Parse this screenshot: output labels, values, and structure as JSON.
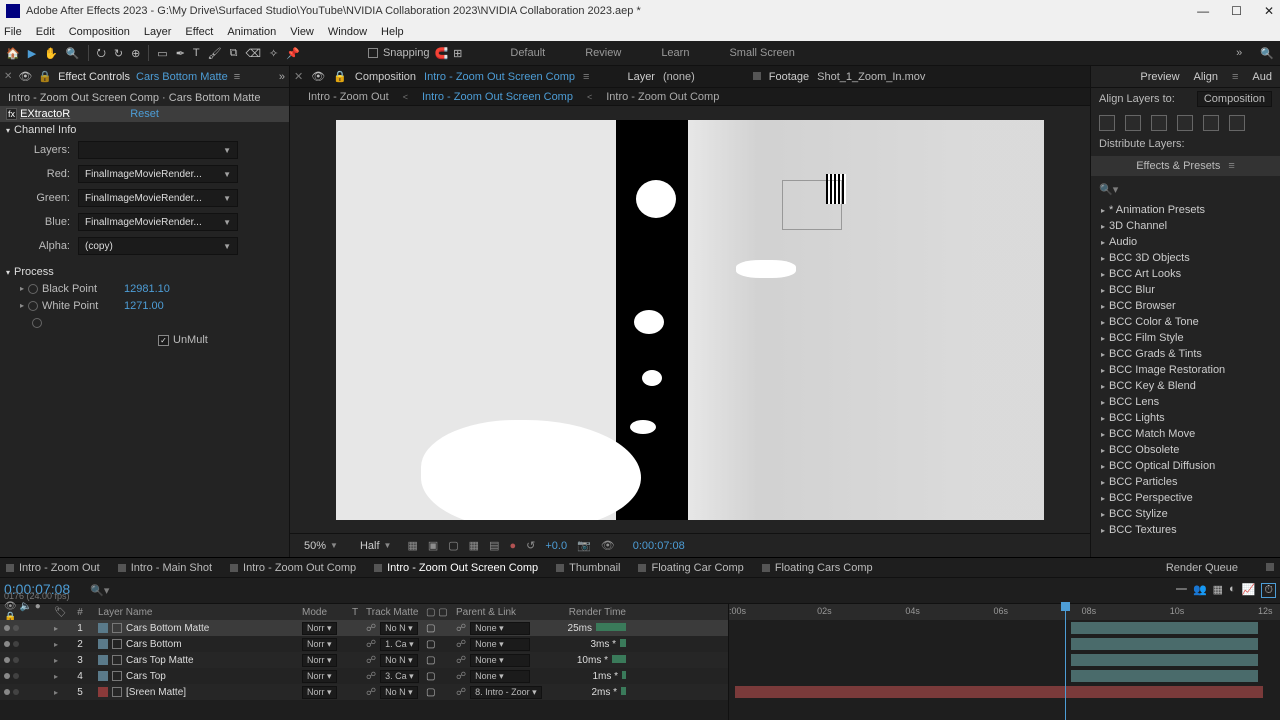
{
  "title": "Adobe After Effects 2023 - G:\\My Drive\\Surfaced Studio\\YouTube\\NVIDIA Collaboration 2023\\NVIDIA Collaboration 2023.aep *",
  "menu": [
    "File",
    "Edit",
    "Composition",
    "Layer",
    "Effect",
    "Animation",
    "View",
    "Window",
    "Help"
  ],
  "toolbar": {
    "snapping": "Snapping"
  },
  "workspaces": [
    "Default",
    "Review",
    "Learn",
    "Small Screen"
  ],
  "effectControls": {
    "title": "Effect Controls",
    "layer": "Cars Bottom Matte",
    "path": "Intro - Zoom Out Screen Comp · Cars Bottom Matte",
    "effect": {
      "name": "EXtractoR",
      "reset": "Reset"
    },
    "section1": "Channel Info",
    "rows": {
      "layers": {
        "label": "Layers:",
        "value": ""
      },
      "red": {
        "label": "Red:",
        "value": "FinalImageMovieRender..."
      },
      "green": {
        "label": "Green:",
        "value": "FinalImageMovieRender..."
      },
      "blue": {
        "label": "Blue:",
        "value": "FinalImageMovieRender..."
      },
      "alpha": {
        "label": "Alpha:",
        "value": "(copy)"
      }
    },
    "section2": "Process",
    "black": {
      "label": "Black Point",
      "value": "12981.10"
    },
    "white": {
      "label": "White Point",
      "value": "1271.00"
    },
    "unmult": {
      "label": "UnMult"
    }
  },
  "compPanel": {
    "title": "Composition",
    "name": "Intro - Zoom Out Screen Comp",
    "layerLabel": "Layer",
    "layerVal": "(none)",
    "footageLabel": "Footage",
    "footageVal": "Shot_1_Zoom_In.mov",
    "sub1": "Intro - Zoom Out",
    "sub2": "Intro - Zoom Out Screen Comp",
    "sub3": "Intro - Zoom Out Comp",
    "footer": {
      "zoom": "50%",
      "res": "Half",
      "exposure": "+0.0",
      "timecode": "0:00:07:08"
    }
  },
  "rightPane": {
    "previewTab": "Preview",
    "alignTab": "Align",
    "audTab": "Aud",
    "alignTo": "Align Layers to:",
    "alignToVal": "Composition",
    "distribute": "Distribute Layers:",
    "epTitle": "Effects & Presets",
    "tree": [
      "* Animation Presets",
      "3D Channel",
      "Audio",
      "BCC 3D Objects",
      "BCC Art Looks",
      "BCC Blur",
      "BCC Browser",
      "BCC Color & Tone",
      "BCC Film Style",
      "BCC Grads & Tints",
      "BCC Image Restoration",
      "BCC Key & Blend",
      "BCC Lens",
      "BCC Lights",
      "BCC Match Move",
      "BCC Obsolete",
      "BCC Optical Diffusion",
      "BCC Particles",
      "BCC Perspective",
      "BCC Stylize",
      "BCC Textures"
    ]
  },
  "timeline": {
    "tabs": [
      "Intro - Zoom Out",
      "Intro - Main Shot",
      "Intro - Zoom Out Comp",
      "Intro - Zoom Out Screen Comp",
      "Thumbnail",
      "Floating Car Comp",
      "Floating Cars Comp"
    ],
    "renderQueue": "Render Queue",
    "timecode": "0:00:07:08",
    "fps": "0176 (24.00 fps)",
    "cols": {
      "layerName": "Layer Name",
      "mode": "Mode",
      "t": "T",
      "trackMatte": "Track Matte",
      "parent": "Parent & Link",
      "render": "Render Time",
      "num": "#"
    },
    "ticks": [
      ":00s",
      "02s",
      "04s",
      "06s",
      "08s",
      "10s",
      "12s"
    ],
    "rows": [
      {
        "num": "1",
        "name": "Cars Bottom Matte",
        "mode": "Norr",
        "matte": "No N",
        "parent": "None",
        "rt": "25ms",
        "lab": "#5a7a8a",
        "sel": true,
        "bar": 30
      },
      {
        "num": "2",
        "name": "Cars Bottom",
        "mode": "Norr",
        "matte": "1. Ca",
        "parent": "None",
        "rt": "3ms *",
        "lab": "#5a7a8a",
        "sel": false,
        "bar": 6
      },
      {
        "num": "3",
        "name": "Cars Top Matte",
        "mode": "Norr",
        "matte": "No N",
        "parent": "None",
        "rt": "10ms *",
        "lab": "#5a7a8a",
        "sel": false,
        "bar": 14
      },
      {
        "num": "4",
        "name": "Cars Top",
        "mode": "Norr",
        "matte": "3. Ca",
        "parent": "None",
        "rt": "1ms *",
        "lab": "#5a7a8a",
        "sel": false,
        "bar": 4
      },
      {
        "num": "5",
        "name": "[Sreen Matte]",
        "mode": "Norr",
        "matte": "No N",
        "parent": "8. Intro - Zoor",
        "rt": "2ms *",
        "lab": "#8a3a3a",
        "sel": false,
        "bar": 5
      }
    ]
  }
}
